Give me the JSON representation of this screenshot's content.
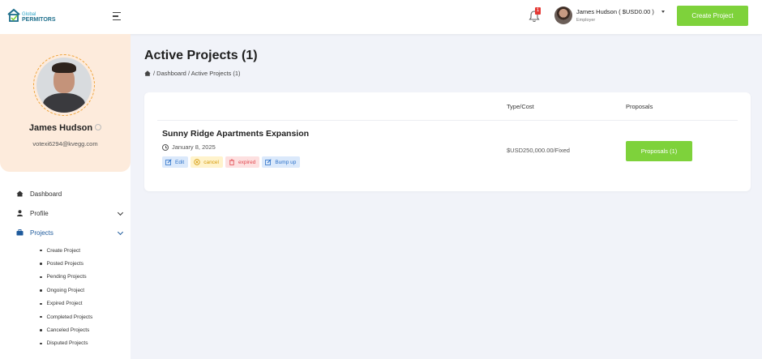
{
  "header": {
    "logo_line1": "Global",
    "logo_line2": "PERMITORS",
    "notification_count": "1",
    "user_display": "James Hudson ( $USD0.00 )",
    "user_role": "Employer",
    "create_project_label": "Create Project"
  },
  "profile": {
    "name": "James Hudson",
    "email": "votexi6294@kvegg.com"
  },
  "sidebar": {
    "items": [
      {
        "label": "Dashboard",
        "icon": "home-icon"
      },
      {
        "label": "Profile",
        "icon": "user-icon"
      },
      {
        "label": "Projects",
        "icon": "briefcase-icon"
      }
    ],
    "project_subitems": [
      "Create Project",
      "Posted Projects",
      "Pending Projects",
      "Ongoing Project",
      "Expired Project",
      "Completed Projects",
      "Canceled Projects",
      "Disputed Projects"
    ]
  },
  "main": {
    "title": "Active Projects (1)",
    "breadcrumb": "/ Dashboard / Active Projects (1)",
    "table": {
      "col_type_cost": "Type/Cost",
      "col_proposals": "Proposals",
      "row": {
        "title": "Sunny Ridge Apartments Expansion",
        "date": "January 8, 2025",
        "tags": {
          "edit": "Edit",
          "cancel": "cancel",
          "expired": "expired",
          "bump": "Bump up"
        },
        "cost": "$USD250,000.00/Fixed",
        "proposals_button": "Proposals (1)"
      }
    }
  },
  "colors": {
    "accent_green": "#7ed23b",
    "profile_bg": "#fdebdc",
    "active_nav": "#1e5a9c",
    "page_bg": "#f1f3f9"
  }
}
